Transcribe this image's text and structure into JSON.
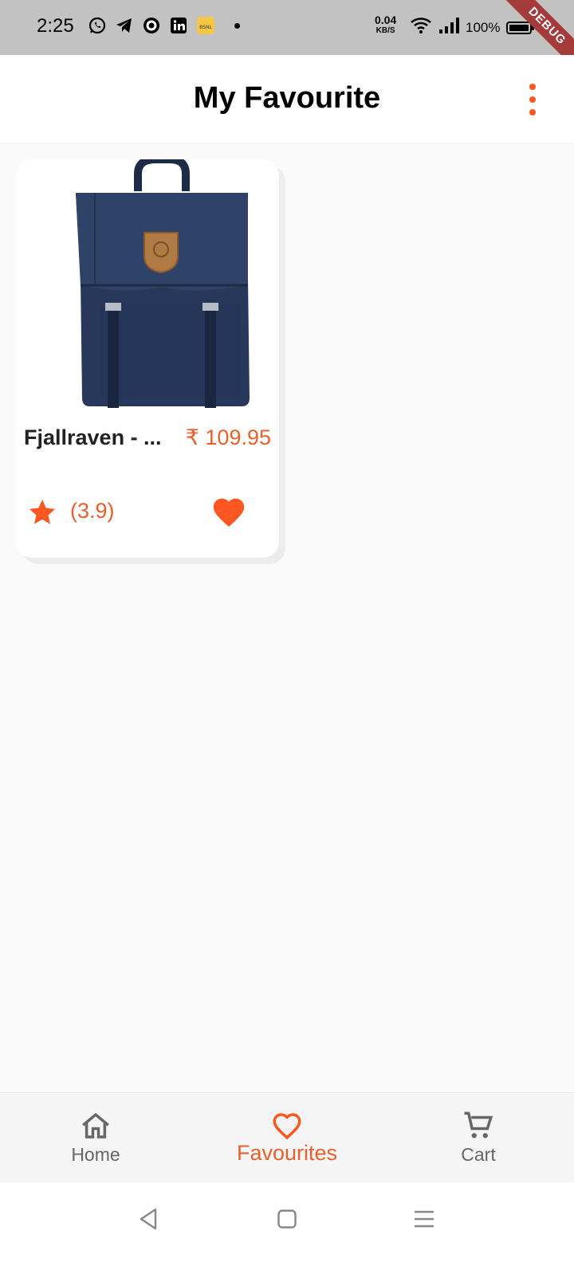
{
  "status_bar": {
    "time": "2:25",
    "net_speed_value": "0.04",
    "net_speed_unit": "KB/S",
    "battery": "100%",
    "debug_label": "DEBUG",
    "icons": [
      "whatsapp-icon",
      "telegram-icon",
      "circle-app-icon",
      "linkedin-icon",
      "bsnl-icon",
      "notification-dot-icon",
      "wifi-icon",
      "signal-icon",
      "battery-icon"
    ]
  },
  "app_bar": {
    "title": "My Favourite",
    "menu_icon": "more-vert-icon"
  },
  "favourites": [
    {
      "title": "Fjallraven - ...",
      "price": "₹ 109.95",
      "rating": "(3.9)",
      "image_icon": "backpack-image",
      "favourited": true
    }
  ],
  "bottom_nav": {
    "items": [
      {
        "label": "Home",
        "icon": "home-icon",
        "active": false
      },
      {
        "label": "Favourites",
        "icon": "heart-icon",
        "active": true
      },
      {
        "label": "Cart",
        "icon": "cart-icon",
        "active": false
      }
    ]
  },
  "colors": {
    "accent": "#ff5722",
    "accent_text": "#e8602c",
    "status_bar": "#c2c2c2",
    "background": "#fafafa"
  }
}
